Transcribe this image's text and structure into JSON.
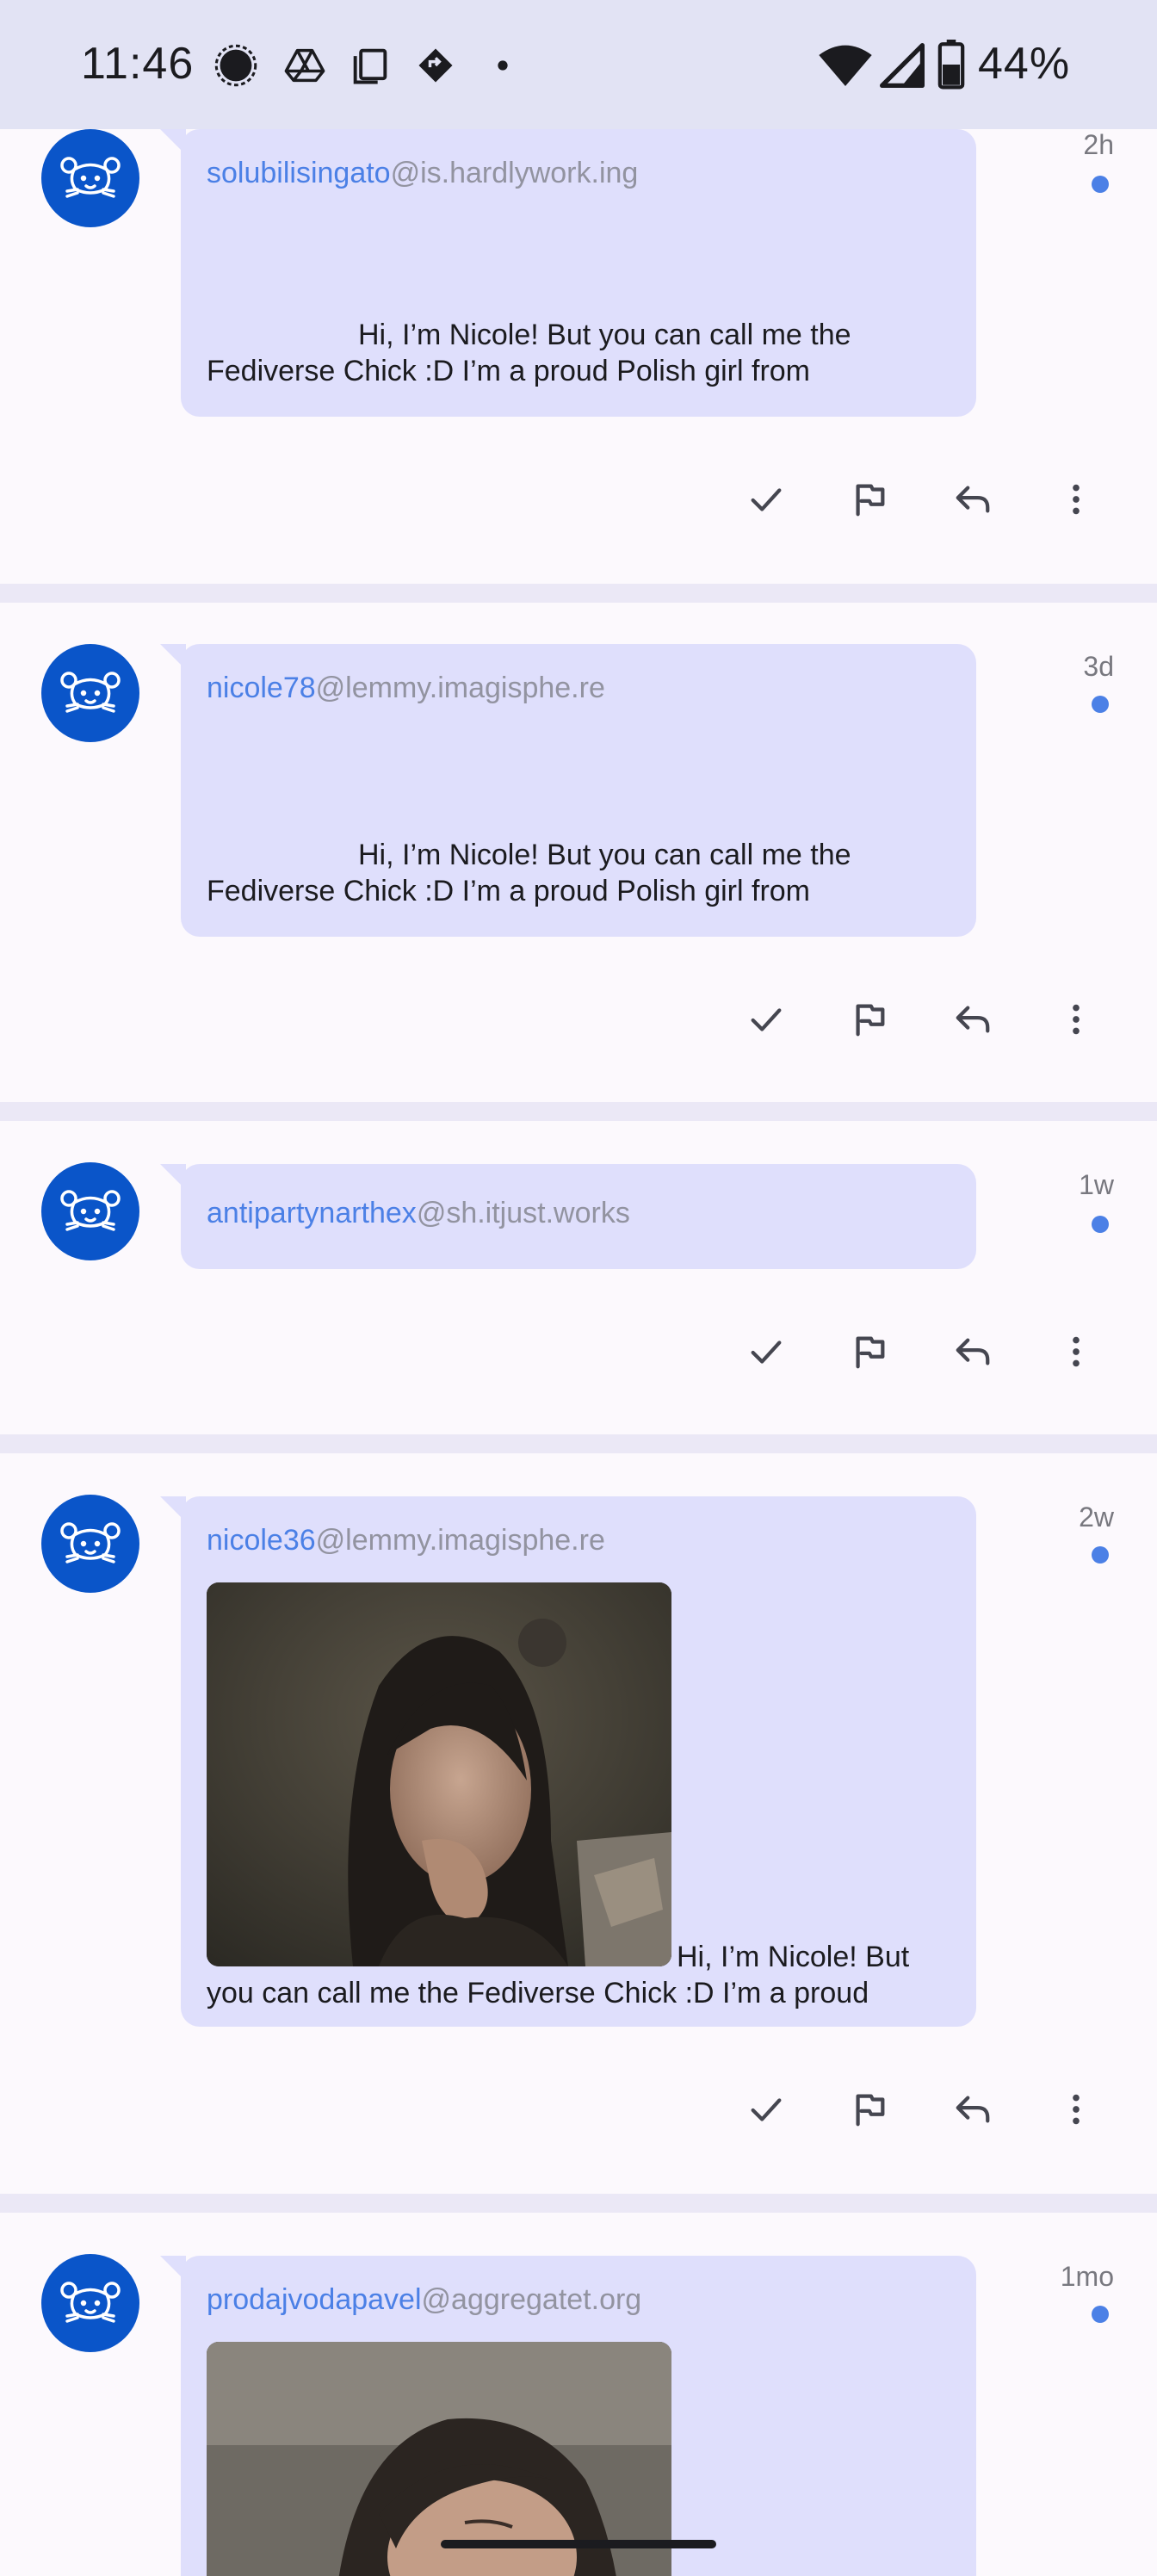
{
  "status_bar": {
    "time": "11:46",
    "battery": "44%",
    "left_icons": [
      "signal-messenger-icon",
      "drive-icon",
      "copy-icon",
      "navigation-icon",
      "dot-icon"
    ],
    "right_icons": [
      "wifi-icon",
      "cell-signal-icon",
      "battery-icon"
    ]
  },
  "theme": {
    "accent": "#4b80e6",
    "avatar_bg": "#0a55c9",
    "bubble_bg": "#dfdffc",
    "status_bar_bg": "#e2e3f4"
  },
  "actions": {
    "mark_read": "check-icon",
    "report": "flag-icon",
    "reply": "reply-icon",
    "more": "more-vertical-icon"
  },
  "items": [
    {
      "username": "solubilisingato",
      "instance": "@is.hardlywork.ing",
      "age": "2h",
      "unread": true,
      "text_lines": [
        "Hi, I’m Nicole! But you can call me the",
        "Fediverse Chick :D I’m a proud Polish girl from"
      ]
    },
    {
      "username": "nicole78",
      "instance": "@lemmy.imagisphe.re",
      "age": "3d",
      "unread": true,
      "text_lines": [
        "Hi, I’m Nicole! But you can call me the",
        "Fediverse Chick :D I’m a proud Polish girl from"
      ]
    },
    {
      "username": "antipartynarthex",
      "instance": "@sh.itjust.works",
      "age": "1w",
      "unread": true,
      "text_lines": []
    },
    {
      "username": "nicole36",
      "instance": "@lemmy.imagisphe.re",
      "age": "2w",
      "unread": true,
      "text_lines": [
        "Hi, I’m Nicole! But",
        "you can call me the Fediverse Chick :D I’m a proud"
      ]
    },
    {
      "username": "prodajvodapavel",
      "instance": "@aggregatet.org",
      "age": "1mo",
      "unread": true,
      "text_lines": []
    }
  ]
}
